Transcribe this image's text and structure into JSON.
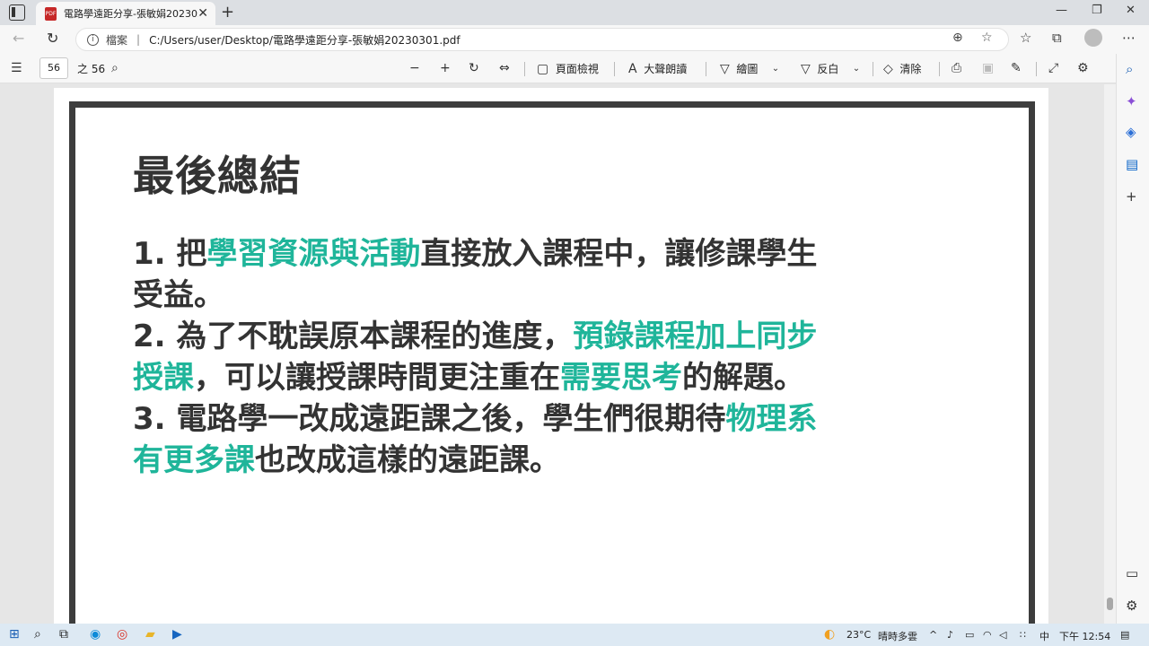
{
  "browser": {
    "tab_title": "電路學遠距分享-張敏娟20230301.pdf",
    "pdf_badge": "PDF",
    "url_label": "檔案",
    "url": "C:/Users/user/Desktop/電路學遠距分享-張敏娟20230301.pdf"
  },
  "pdf_toolbar": {
    "page_number": "56",
    "page_total": "之 56",
    "page_view": "頁面檢視",
    "read_aloud": "大聲朗讀",
    "draw": "繪圖",
    "highlight": "反白",
    "erase": "清除"
  },
  "slide": {
    "title": "最後總結",
    "items": [
      {
        "prefix": "1. 把",
        "hl1": "學習資源與活動",
        "mid1": "直接放入課程中，讓修課學生受益。",
        "hl2": "",
        "mid2": "",
        "hl3": "",
        "suffix": ""
      },
      {
        "prefix": "2. 為了不耽誤原本課程的進度，",
        "hl1": "預錄課程加上同步授課",
        "mid1": "，可以讓授課時間更注重在",
        "hl2": "需要思考",
        "mid2": "的解題。",
        "hl3": "",
        "suffix": ""
      },
      {
        "prefix": "3. 電路學一改成遠距課之後，學生們很期待",
        "hl1": "物理系有更多課",
        "mid1": "也改成這樣的遠距課。",
        "hl2": "",
        "mid2": "",
        "hl3": "",
        "suffix": ""
      }
    ]
  },
  "taskbar": {
    "weather": "23°C",
    "weather_desc": "晴時多雲",
    "ime": "中",
    "time": "下午 12:54"
  }
}
